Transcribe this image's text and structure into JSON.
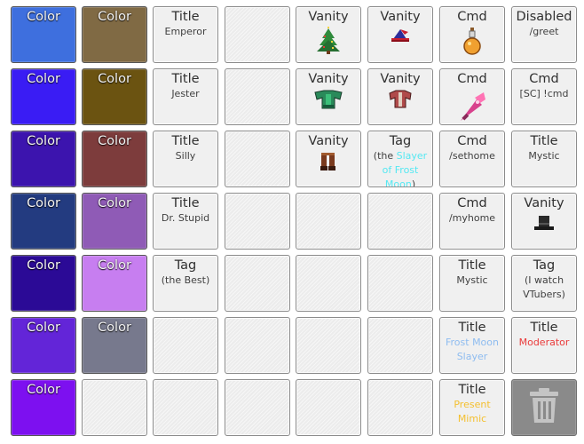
{
  "slots": {
    "r0c0": {
      "head": "Color",
      "color": "#3e6fde"
    },
    "r0c1": {
      "head": "Color",
      "color": "#806a44"
    },
    "r0c2": {
      "head": "Title",
      "sub": "Emperor"
    },
    "r0c4": {
      "head": "Vanity",
      "icon": "pine-tree-icon"
    },
    "r0c5": {
      "head": "Vanity",
      "icon": "wizard-hat-icon"
    },
    "r0c6": {
      "head": "Cmd",
      "icon": "potion-flask-icon"
    },
    "r0c7": {
      "head": "Disabled",
      "sub": "/greet"
    },
    "r1c0": {
      "head": "Color",
      "color": "#3a1cf4"
    },
    "r1c1": {
      "head": "Color",
      "color": "#6b5311"
    },
    "r1c2": {
      "head": "Title",
      "sub": "Jester"
    },
    "r1c4": {
      "head": "Vanity",
      "icon": "green-armor-icon"
    },
    "r1c5": {
      "head": "Vanity",
      "icon": "red-shirt-icon"
    },
    "r1c6": {
      "head": "Cmd",
      "icon": "pink-drill-icon"
    },
    "r1c7": {
      "head": "Cmd",
      "sub": "[SC] !cmd"
    },
    "r2c0": {
      "head": "Color",
      "color": "#3c14ae"
    },
    "r2c1": {
      "head": "Color",
      "color": "#7d3c3c"
    },
    "r2c2": {
      "head": "Title",
      "sub": "Silly"
    },
    "r2c4": {
      "head": "Vanity",
      "icon": "brown-boots-icon"
    },
    "r2c5": {
      "head": "Tag",
      "pre": "(the ",
      "hl": "Slayer of Frost Moon",
      "post": ")",
      "hl_color": "#55e8f2"
    },
    "r2c6": {
      "head": "Cmd",
      "sub": "/sethome"
    },
    "r2c7": {
      "head": "Title",
      "sub": "Mystic"
    },
    "r3c0": {
      "head": "Color",
      "color": "#233b80"
    },
    "r3c1": {
      "head": "Color",
      "color": "#8f5bb6"
    },
    "r3c2": {
      "head": "Title",
      "sub": "Dr. Stupid"
    },
    "r3c6": {
      "head": "Cmd",
      "sub": "/myhome"
    },
    "r3c7": {
      "head": "Vanity",
      "icon": "top-hat-icon"
    },
    "r4c0": {
      "head": "Color",
      "color": "#2b0a96"
    },
    "r4c1": {
      "head": "Color",
      "color": "#c77ef0"
    },
    "r4c2": {
      "head": "Tag",
      "sub": "(the Best)"
    },
    "r4c6": {
      "head": "Title",
      "sub": "Mystic"
    },
    "r4c7": {
      "head": "Tag",
      "sub": "(I watch VTubers)"
    },
    "r5c0": {
      "head": "Color",
      "color": "#6325d8"
    },
    "r5c1": {
      "head": "Color",
      "color": "#77798d"
    },
    "r5c6": {
      "head": "Title",
      "sub": "Frost Moon Slayer",
      "sub_color": "#8ebcf0"
    },
    "r5c7": {
      "head": "Title",
      "sub": "Moderator",
      "sub_color": "#ea3a3a"
    },
    "r6c0": {
      "head": "Color",
      "color": "#7d10f0"
    },
    "r6c6": {
      "head": "Title",
      "sub": "Present Mimic",
      "sub_color": "#f4c030"
    }
  },
  "trash": {
    "icon": "trash-can-icon"
  }
}
